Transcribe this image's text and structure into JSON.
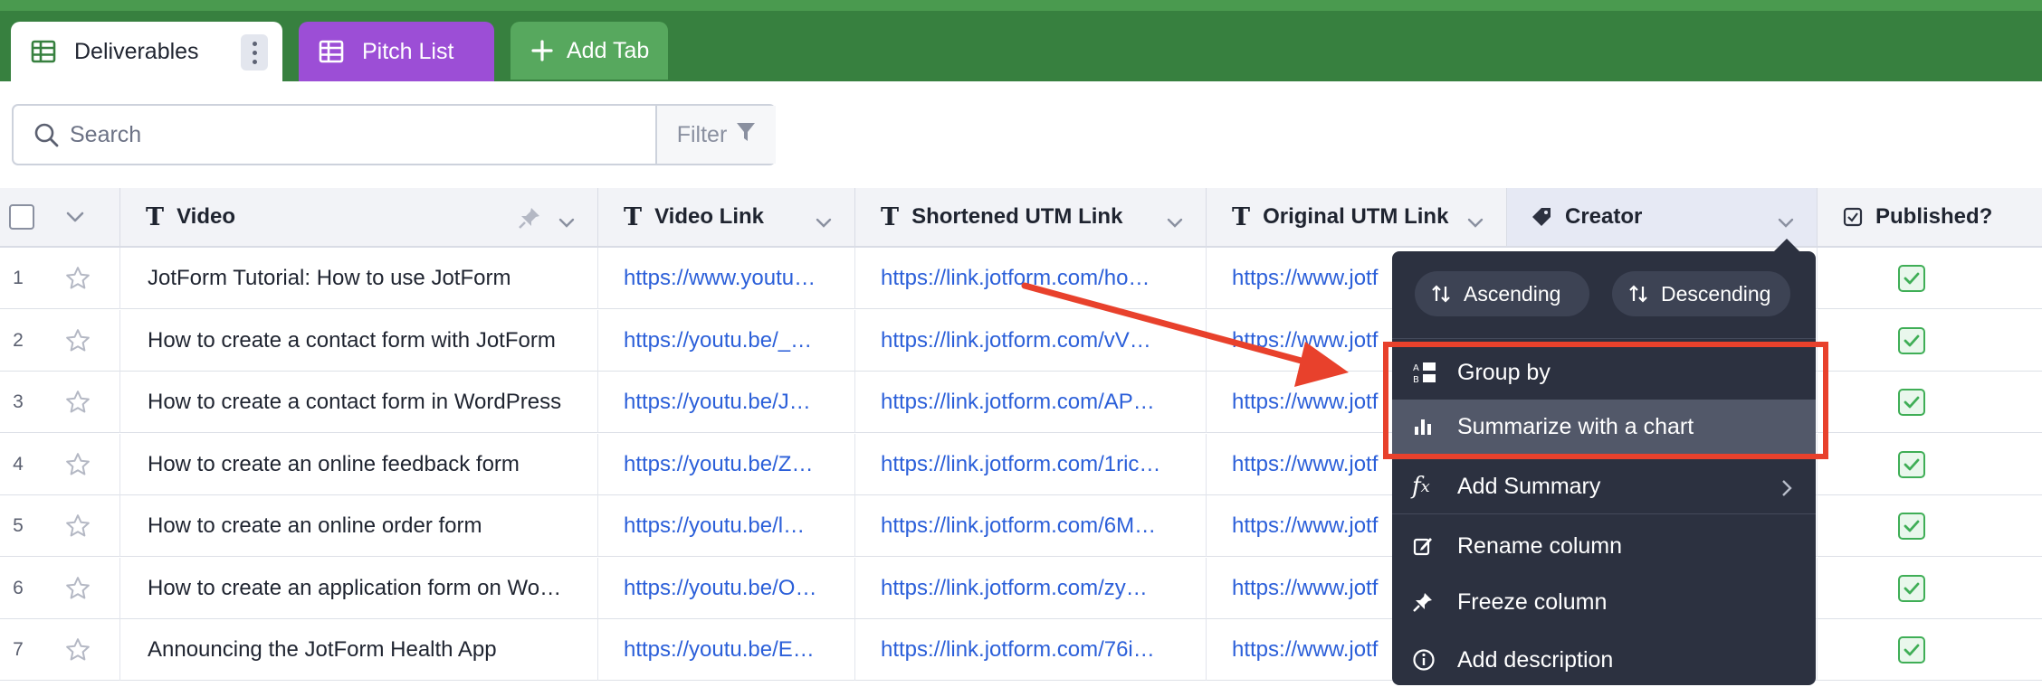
{
  "tabs": {
    "deliverables": "Deliverables",
    "pitch_list": "Pitch List",
    "add_tab": "Add Tab"
  },
  "toolbar": {
    "search_placeholder": "Search",
    "filter_label": "Filter"
  },
  "columns": {
    "video": "Video",
    "video_link": "Video Link",
    "shortened_utm": "Shortened UTM Link",
    "original_utm": "Original UTM Link",
    "creator": "Creator",
    "published": "Published?"
  },
  "rows": [
    {
      "num": "1",
      "video": "JotForm Tutorial: How to use JotForm",
      "video_link": "https://www.youtu…",
      "short_link": "https://link.jotform.com/ho…",
      "orig_link": "https://www.jotf"
    },
    {
      "num": "2",
      "video": "How to create a contact form with JotForm",
      "video_link": "https://youtu.be/_…",
      "short_link": "https://link.jotform.com/vV…",
      "orig_link": "https://www.jotf"
    },
    {
      "num": "3",
      "video": "How to create a contact form in WordPress",
      "video_link": "https://youtu.be/J…",
      "short_link": "https://link.jotform.com/AP…",
      "orig_link": "https://www.jotf"
    },
    {
      "num": "4",
      "video": "How to create an online feedback form",
      "video_link": "https://youtu.be/Z…",
      "short_link": "https://link.jotform.com/1ric…",
      "orig_link": "https://www.jotf"
    },
    {
      "num": "5",
      "video": "How to create an online order form",
      "video_link": "https://youtu.be/l…",
      "short_link": "https://link.jotform.com/6M…",
      "orig_link": "https://www.jotf"
    },
    {
      "num": "6",
      "video": "How to create an application form on Wo…",
      "video_link": "https://youtu.be/O…",
      "short_link": "https://link.jotform.com/zy…",
      "orig_link": "https://www.jotf"
    },
    {
      "num": "7",
      "video": "Announcing the JotForm Health App",
      "video_link": "https://youtu.be/E…",
      "short_link": "https://link.jotform.com/76i…",
      "orig_link": "https://www.jotf"
    }
  ],
  "menu": {
    "ascending": "Ascending",
    "descending": "Descending",
    "group_by": "Group by",
    "summarize_chart": "Summarize with a chart",
    "add_summary": "Add Summary",
    "rename_column": "Rename column",
    "freeze_column": "Freeze column",
    "add_description": "Add description"
  },
  "colors": {
    "topbar": "#37803f",
    "pitch_tab": "#9c4ed6",
    "add_tab": "#57a85e",
    "link": "#2b5fd9",
    "menu_bg": "#2c3140",
    "highlight_box": "#e8412c",
    "checkbox": "#3fae56"
  }
}
